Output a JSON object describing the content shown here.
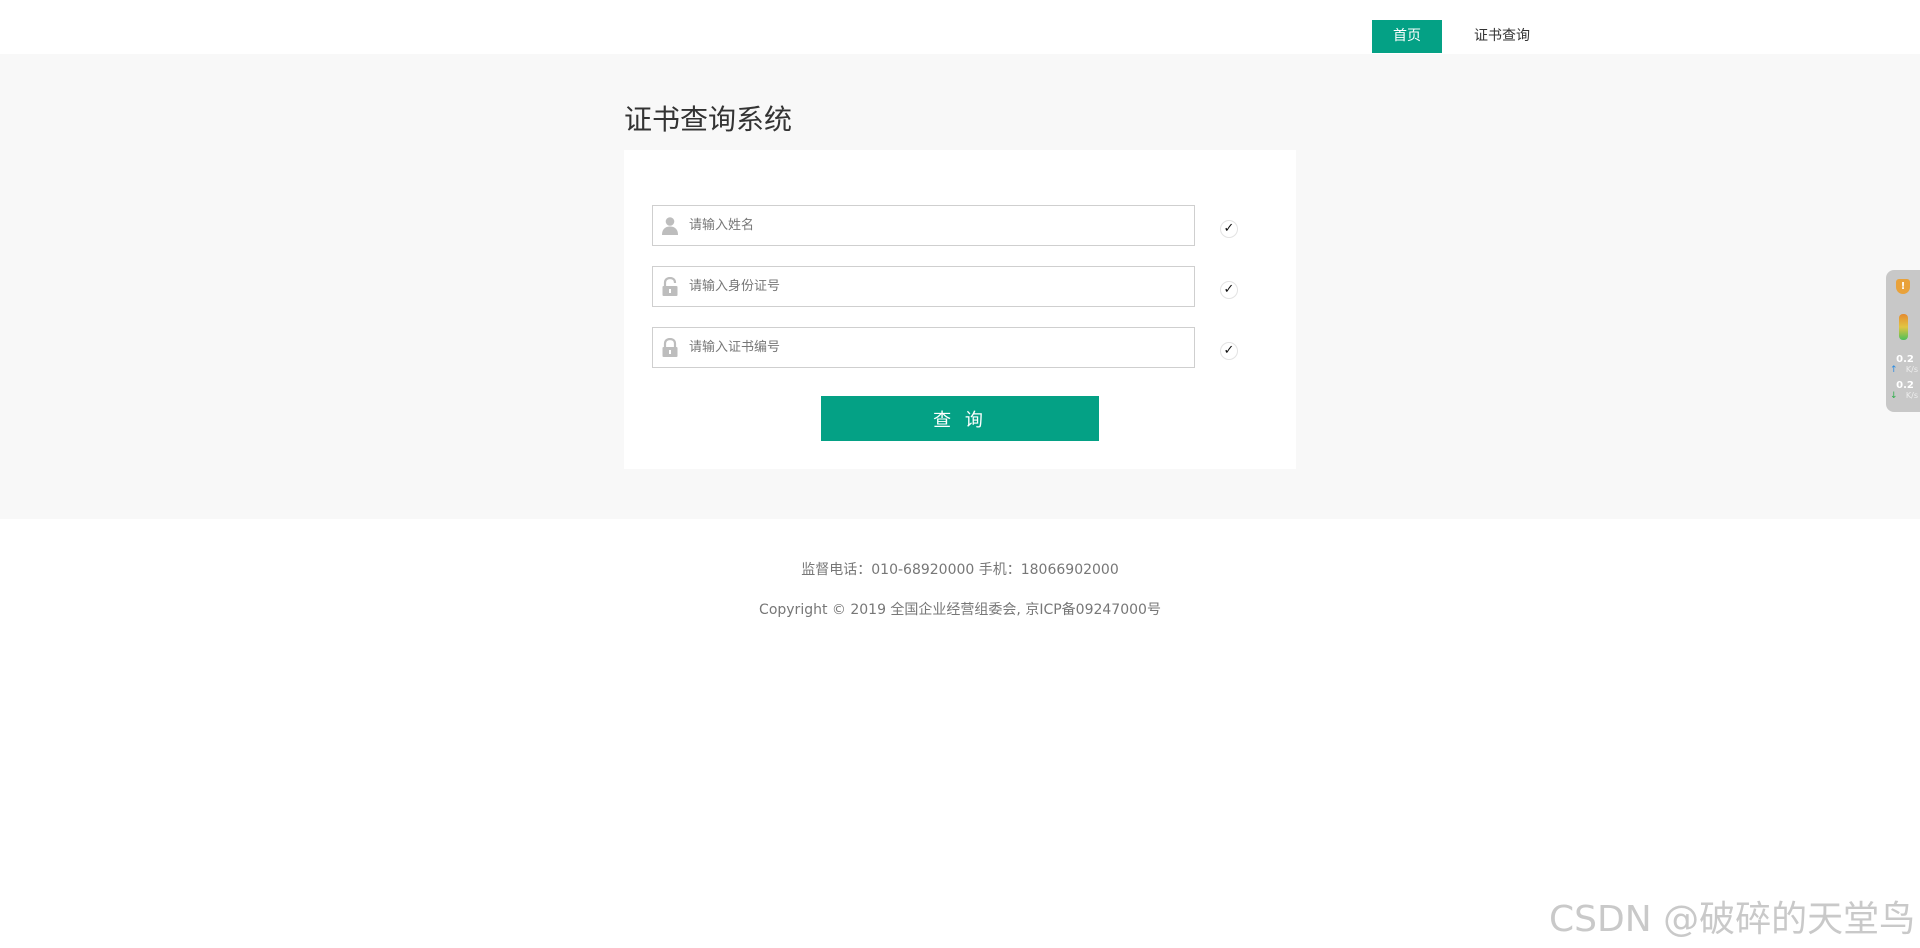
{
  "nav": {
    "home_label": "首页",
    "cert_query_label": "证书查询"
  },
  "main": {
    "title": "证书查询系统",
    "fields": [
      {
        "placeholder": "请输入姓名",
        "value": "",
        "icon": "user-icon"
      },
      {
        "placeholder": "请输入身份证号",
        "value": "",
        "icon": "lock-icon"
      },
      {
        "placeholder": "请输入证书编号",
        "value": "",
        "icon": "lock-icon"
      }
    ],
    "check_mark": "✓",
    "query_button": "查 询"
  },
  "footer": {
    "contact": "监督电话：010-68920000  手机：18066902000",
    "copyright": "Copyright © 2019 全国企业经营组委会, 京ICP备09247000号"
  },
  "side_widget": {
    "alert_badge": "!",
    "upload_speed": "0.2",
    "upload_unit": "K/s",
    "download_speed": "0.2",
    "download_unit": "K/s"
  },
  "watermark": "CSDN @破碎的天堂鸟",
  "colors": {
    "accent": "#04a185",
    "band_background": "#f8f8f8"
  }
}
